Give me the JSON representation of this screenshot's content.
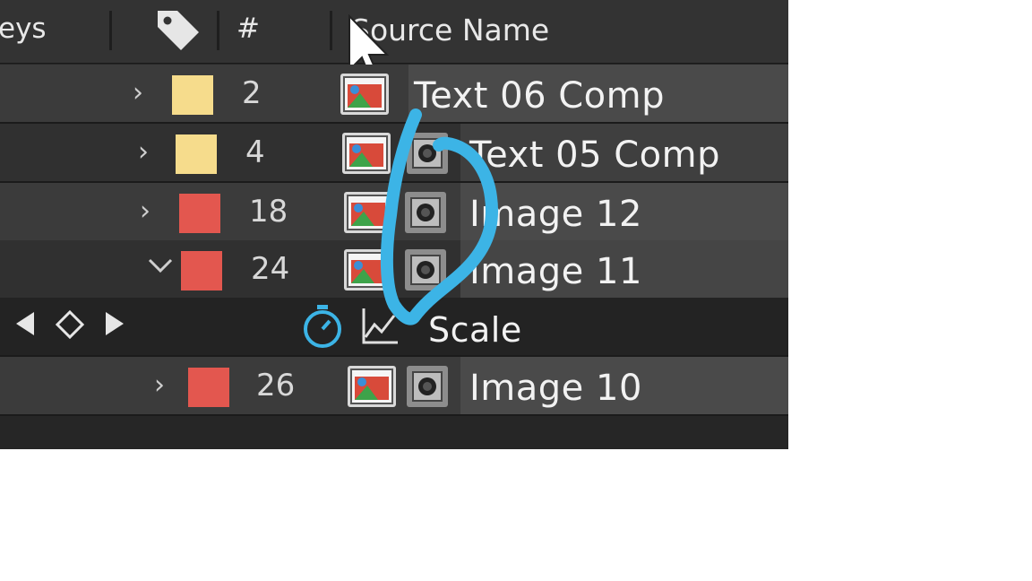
{
  "header": {
    "keys_label": "eys",
    "number_label": "#",
    "source_name_label": "Source Name"
  },
  "colors": {
    "yellow_label": "#f6dc8c",
    "red_label": "#e3574f",
    "annotation": "#3cb4e6"
  },
  "layers": [
    {
      "number": "2",
      "name": "Text 06 Comp",
      "label_color": "yellow",
      "expanded": false,
      "lens_icon": false
    },
    {
      "number": "4",
      "name": "Text 05 Comp",
      "label_color": "yellow",
      "expanded": false,
      "lens_icon": true
    },
    {
      "number": "18",
      "name": "Image 12",
      "label_color": "red",
      "expanded": false,
      "lens_icon": true
    },
    {
      "number": "24",
      "name": "Image 11",
      "label_color": "red",
      "expanded": true,
      "lens_icon": true
    },
    {
      "number": "26",
      "name": "Image 10",
      "label_color": "red",
      "expanded": false,
      "lens_icon": true
    }
  ],
  "property": {
    "name": "Scale",
    "icons": [
      "stopwatch-icon",
      "graph-icon"
    ]
  },
  "keyframe_nav": [
    "prev-keyframe-icon",
    "add-keyframe-icon",
    "next-keyframe-icon"
  ],
  "icons": {
    "label_column": "tag-icon",
    "expand_collapsed": "chevron-right-icon",
    "expand_open": "chevron-down-icon",
    "comp": "composition-icon",
    "lens": "lens-icon",
    "cursor": "mouse-cursor-icon"
  }
}
